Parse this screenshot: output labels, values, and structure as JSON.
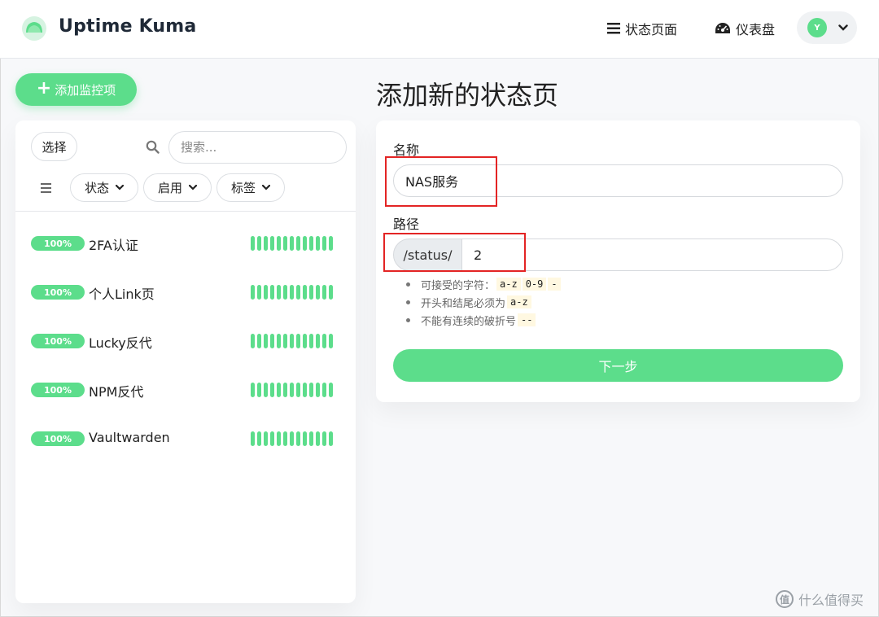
{
  "app": {
    "brand": "Uptime Kuma"
  },
  "header": {
    "status_page_label": "状态页面",
    "dashboard_label": "仪表盘",
    "avatar_initial": "Y"
  },
  "sidebar": {
    "add_monitor_label": "添加监控项",
    "select_label": "选择",
    "search_placeholder": "搜索...",
    "filters": {
      "status": "状态",
      "active": "启用",
      "tags": "标签"
    },
    "monitors": [
      {
        "uptime": "100%",
        "name": "2FA认证"
      },
      {
        "uptime": "100%",
        "name": "个人Link页"
      },
      {
        "uptime": "100%",
        "name": "Lucky反代"
      },
      {
        "uptime": "100%",
        "name": "NPM反代"
      },
      {
        "uptime": "100%",
        "name": "Vaultwarden"
      }
    ],
    "heartbeat_color": "#5cdd8b"
  },
  "form": {
    "title": "添加新的状态页",
    "name_label": "名称",
    "name_value": "NAS服务",
    "path_label": "路径",
    "path_prefix": "/status/",
    "path_value": "2",
    "rules": {
      "r1_text": "可接受的字符：",
      "r1_codes": [
        "a-z",
        "0-9",
        "-"
      ],
      "r2_text": "开头和结尾必须为",
      "r2_code": "a-z",
      "r3_text": "不能有连续的破折号",
      "r3_code": "--"
    },
    "next_label": "下一步"
  },
  "watermark": {
    "icon_text": "值",
    "text": "什么值得买"
  },
  "colors": {
    "accent": "#5cdd8b",
    "annotation": "#e32424"
  }
}
